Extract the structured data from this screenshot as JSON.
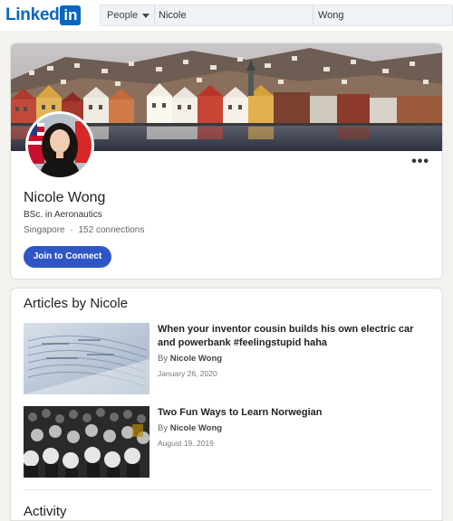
{
  "header": {
    "logo_text": "Linked",
    "logo_in": "in",
    "search": {
      "category": "People",
      "first_name": "Nicole",
      "last_name": "Wong"
    }
  },
  "profile": {
    "name": "Nicole Wong",
    "headline": "BSc. in Aeronautics",
    "location": "Singapore",
    "separator": "·",
    "connections": "152 connections",
    "join_button": "Join to Connect",
    "more_menu": "•••"
  },
  "articles": {
    "title": "Articles by Nicole",
    "items": [
      {
        "title": "When your inventor cousin builds his own electric car and powerbank #feelingstupid haha",
        "by_prefix": "By",
        "author": "Nicole Wong",
        "date": "January 26, 2020"
      },
      {
        "title": "Two Fun Ways to Learn Norwegian",
        "by_prefix": "By",
        "author": "Nicole Wong",
        "date": "August 19, 2019"
      }
    ]
  },
  "activity": {
    "title": "Activity"
  },
  "colors": {
    "brand": "#0a66c2",
    "button": "#2f56c6",
    "page_bg": "#f3f2ef"
  }
}
